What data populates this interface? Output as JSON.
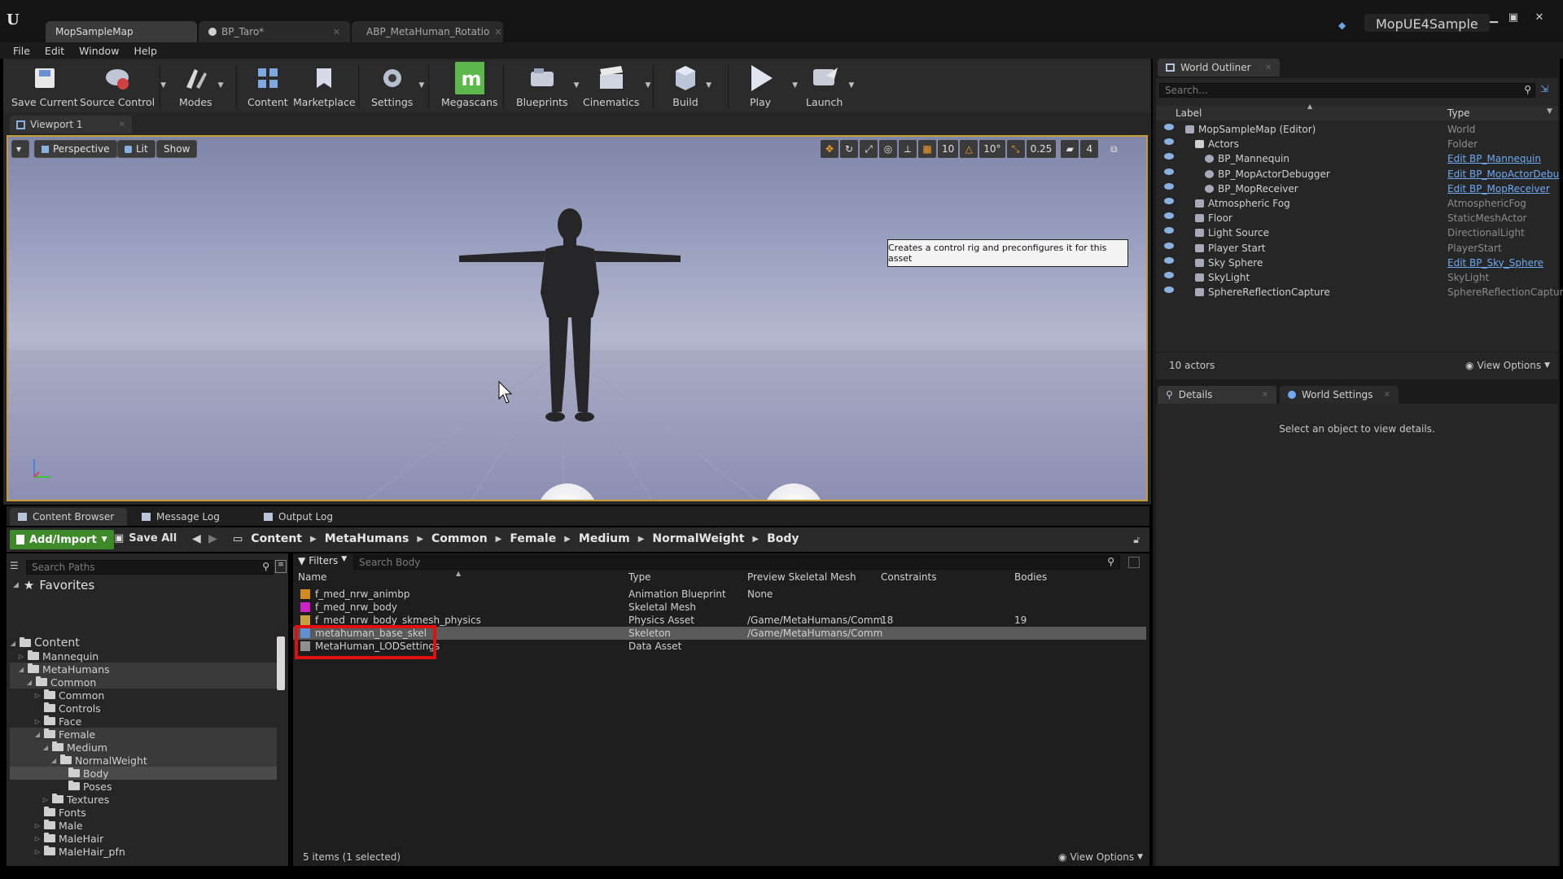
{
  "title_tabs": [
    {
      "label": "MopSampleMap"
    },
    {
      "label": "BP_Taro*"
    },
    {
      "label": "ABP_MetaHuman_Rotatio"
    }
  ],
  "project_name": "MopUE4Sample",
  "menu": [
    "File",
    "Edit",
    "Window",
    "Help"
  ],
  "toolbar": [
    "Save Current",
    "Source Control",
    "Modes",
    "Content",
    "Marketplace",
    "Settings",
    "Megascans",
    "Blueprints",
    "Cinematics",
    "Build",
    "Play",
    "Launch"
  ],
  "viewport": {
    "tab": "Viewport 1",
    "perspective": "Perspective",
    "lit": "Lit",
    "show": "Show",
    "grid_snap": "10",
    "rot_snap": "10°",
    "scale_snap": "0.25",
    "cam_speed": "4",
    "tooltip": "Creates a control rig and preconfigures it for this asset"
  },
  "bottom_tabs": [
    "Content Browser",
    "Message Log",
    "Output Log"
  ],
  "content_browser": {
    "add_import": "Add/Import",
    "save_all": "Save All",
    "breadcrumbs": [
      "Content",
      "MetaHumans",
      "Common",
      "Female",
      "Medium",
      "NormalWeight",
      "Body"
    ],
    "search_paths": "Search Paths",
    "favorites": "Favorites",
    "filters": "Filters",
    "search_body": "Search Body",
    "columns": [
      "Name",
      "Type",
      "Preview Skeletal Mesh",
      "Constraints",
      "Bodies"
    ],
    "assets": [
      {
        "name": "f_med_nrw_animbp",
        "type": "Animation Blueprint",
        "mesh": "None",
        "constraints": "",
        "bodies": "",
        "color": "#d08a20"
      },
      {
        "name": "f_med_nrw_body",
        "type": "Skeletal Mesh",
        "mesh": "",
        "constraints": "",
        "bodies": "",
        "color": "#d020c8"
      },
      {
        "name": "f_med_nrw_body_skmesh_physics",
        "type": "Physics Asset",
        "mesh": "/Game/MetaHumans/Comm",
        "constraints": "18",
        "bodies": "19",
        "color": "#c8a040"
      },
      {
        "name": "metahuman_base_skel",
        "type": "Skeleton",
        "mesh": "/Game/MetaHumans/Comm",
        "constraints": "",
        "bodies": "",
        "color": "#6090d0"
      },
      {
        "name": "MetaHuman_LODSettings",
        "type": "Data Asset",
        "mesh": "",
        "constraints": "",
        "bodies": "",
        "color": "#909090"
      }
    ],
    "tree": [
      {
        "label": "Content",
        "depth": 0,
        "open": true
      },
      {
        "label": "Mannequin",
        "depth": 1,
        "open": false
      },
      {
        "label": "MetaHumans",
        "depth": 1,
        "open": true
      },
      {
        "label": "Common",
        "depth": 2,
        "open": true
      },
      {
        "label": "Common",
        "depth": 3,
        "open": false
      },
      {
        "label": "Controls",
        "depth": 3,
        "open": null
      },
      {
        "label": "Face",
        "depth": 3,
        "open": false
      },
      {
        "label": "Female",
        "depth": 3,
        "open": true
      },
      {
        "label": "Medium",
        "depth": 4,
        "open": true
      },
      {
        "label": "NormalWeight",
        "depth": 5,
        "open": true
      },
      {
        "label": "Body",
        "depth": 6,
        "open": null
      },
      {
        "label": "Poses",
        "depth": 6,
        "open": null
      },
      {
        "label": "Textures",
        "depth": 4,
        "open": false
      },
      {
        "label": "Fonts",
        "depth": 3,
        "open": null
      },
      {
        "label": "Male",
        "depth": 3,
        "open": false
      },
      {
        "label": "MaleHair",
        "depth": 3,
        "open": false
      },
      {
        "label": "MaleHair_pfn",
        "depth": 3,
        "open": false
      }
    ],
    "status": "5 items (1 selected)",
    "view_options": "View Options"
  },
  "outliner": {
    "tab": "World Outliner",
    "search": "Search...",
    "label_col": "Label",
    "type_col": "Type",
    "rows": [
      {
        "label": "MopSampleMap (Editor)",
        "type": "World",
        "depth": 0,
        "link": false
      },
      {
        "label": "Actors",
        "type": "Folder",
        "depth": 1,
        "link": false
      },
      {
        "label": "BP_Mannequin",
        "type": "Edit BP_Mannequin",
        "depth": 2,
        "link": true
      },
      {
        "label": "BP_MopActorDebugger",
        "type": "Edit BP_MopActorDebu",
        "depth": 2,
        "link": true
      },
      {
        "label": "BP_MopReceiver",
        "type": "Edit BP_MopReceiver",
        "depth": 2,
        "link": true
      },
      {
        "label": "Atmospheric Fog",
        "type": "AtmosphericFog",
        "depth": 1,
        "link": false
      },
      {
        "label": "Floor",
        "type": "StaticMeshActor",
        "depth": 1,
        "link": false
      },
      {
        "label": "Light Source",
        "type": "DirectionalLight",
        "depth": 1,
        "link": false
      },
      {
        "label": "Player Start",
        "type": "PlayerStart",
        "depth": 1,
        "link": false
      },
      {
        "label": "Sky Sphere",
        "type": "Edit BP_Sky_Sphere",
        "depth": 1,
        "link": true
      },
      {
        "label": "SkyLight",
        "type": "SkyLight",
        "depth": 1,
        "link": false
      },
      {
        "label": "SphereReflectionCapture",
        "type": "SphereReflectionCapture",
        "depth": 1,
        "link": false
      }
    ],
    "count": "10 actors",
    "view_options": "View Options"
  },
  "details": {
    "tab1": "Details",
    "tab2": "World Settings",
    "empty": "Select an object to view details."
  }
}
